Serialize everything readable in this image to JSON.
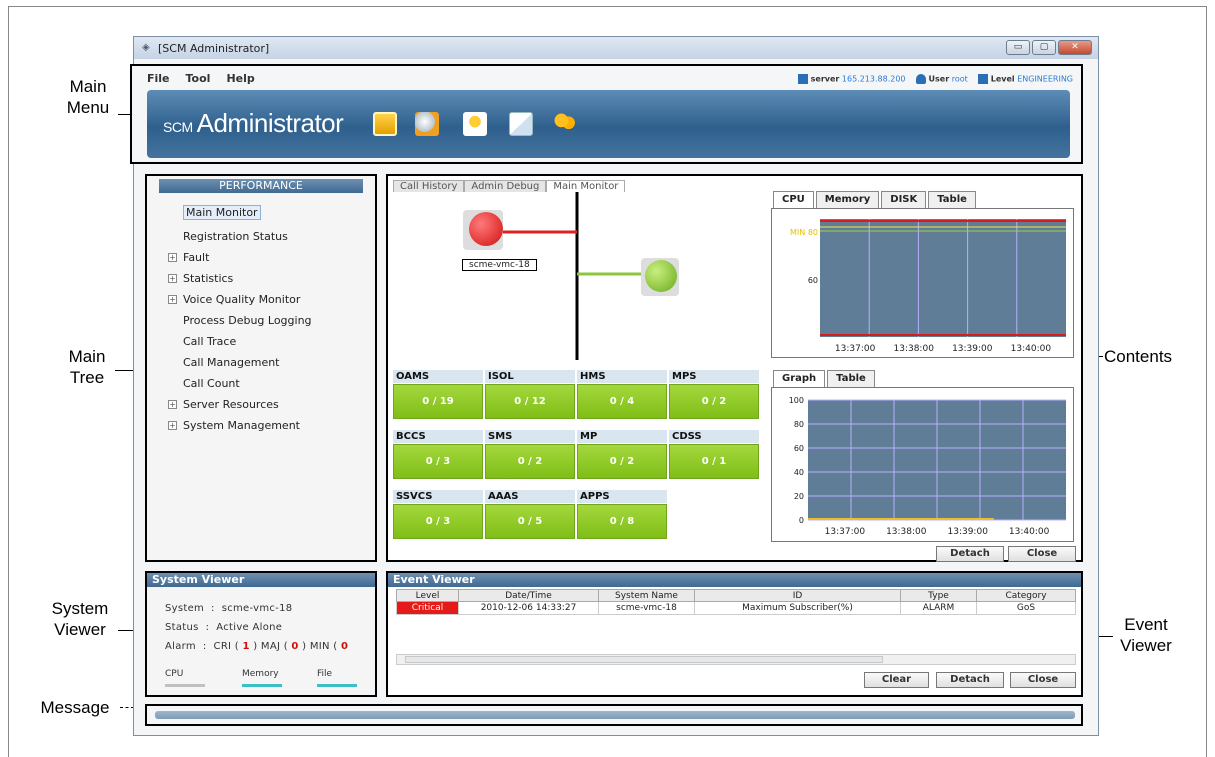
{
  "callouts": {
    "main_menu": "Main\nMenu",
    "main_tree": "Main\nTree",
    "system_viewer": "System\nViewer",
    "message": "Message",
    "contents": "Contents",
    "event_viewer": "Event\nViewer"
  },
  "window": {
    "title": "[SCM Administrator]",
    "btn_min": "▭",
    "btn_max": "▢",
    "btn_close": "✕"
  },
  "menu": {
    "items": [
      "File",
      "Tool",
      "Help"
    ],
    "server_label": "server",
    "server_value": "165.213.88.200",
    "user_label": "User",
    "user_value": "root",
    "level_label": "Level",
    "level_value": "ENGINEERING"
  },
  "banner": {
    "logo_prefix": "SCM",
    "logo_text": "Administrator",
    "toolbar_icons": [
      "performance-report-icon",
      "config-gear-icon",
      "monitor-icon",
      "mail-icon",
      "users-icon"
    ]
  },
  "tree": {
    "header": "PERFORMANCE",
    "items": [
      {
        "label": "Main Monitor",
        "expandable": false
      },
      {
        "label": "Registration Status",
        "expandable": false
      },
      {
        "label": "Fault",
        "expandable": true
      },
      {
        "label": "Statistics",
        "expandable": true
      },
      {
        "label": "Voice Quality Monitor",
        "expandable": true
      },
      {
        "label": "Process Debug Logging",
        "expandable": false
      },
      {
        "label": "Call Trace",
        "expandable": false
      },
      {
        "label": "Call Management",
        "expandable": false
      },
      {
        "label": "Call Count",
        "expandable": false
      },
      {
        "label": "Server Resources",
        "expandable": true
      },
      {
        "label": "System Management",
        "expandable": true
      }
    ]
  },
  "system_viewer": {
    "title": "System Viewer",
    "system_label": "System",
    "system_value": "scme-vmc-18",
    "status_label": "Status",
    "status_value": "Active Alone",
    "alarm_label": "Alarm",
    "cri_label": "CRI",
    "cri_value": "1",
    "maj_label": "MAJ",
    "maj_value": "0",
    "min_label": "MIN",
    "min_value": "0",
    "meters": [
      "CPU",
      "Memory",
      "File"
    ]
  },
  "contents": {
    "top_tabs": [
      "Call History",
      "Admin Debug",
      "Main Monitor"
    ],
    "node_label": "scme-vmc-18",
    "tiles": [
      {
        "name": "OAMS",
        "value": "0 / 19"
      },
      {
        "name": "ISOL",
        "value": "0 / 12"
      },
      {
        "name": "HMS",
        "value": "0 / 4"
      },
      {
        "name": "MPS",
        "value": "0 / 2"
      },
      {
        "name": "BCCS",
        "value": "0 / 3"
      },
      {
        "name": "SMS",
        "value": "0 / 2"
      },
      {
        "name": "MP",
        "value": "0 / 2"
      },
      {
        "name": "CDSS",
        "value": "0 / 1"
      },
      {
        "name": "SSVCS",
        "value": "0 / 3"
      },
      {
        "name": "AAAS",
        "value": "0 / 5"
      },
      {
        "name": "APPS",
        "value": "0 / 8"
      }
    ],
    "chart_tabs_top": [
      "CPU",
      "Memory",
      "DISK",
      "Table"
    ],
    "chart_tabs_bottom": [
      "Graph",
      "Table"
    ],
    "detach_label": "Detach",
    "close_label": "Close"
  },
  "chart_data": [
    {
      "type": "line",
      "title": "",
      "x": [
        "13:37:00",
        "13:38:00",
        "13:39:00",
        "13:40:00"
      ],
      "ytick_labels": [
        "MIN 80",
        "60"
      ],
      "grid": true
    },
    {
      "type": "line",
      "title": "",
      "x": [
        "13:37:00",
        "13:38:00",
        "13:39:00",
        "13:40:00"
      ],
      "ylim": [
        0,
        100
      ],
      "yticks": [
        0,
        20,
        40,
        60,
        80,
        100
      ],
      "grid": true
    }
  ],
  "event_viewer": {
    "title": "Event Viewer",
    "columns": [
      "Level",
      "Date/Time",
      "System Name",
      "ID",
      "Type",
      "Category"
    ],
    "rows": [
      [
        "Critical",
        "2010-12-06 14:33:27",
        "scme-vmc-18",
        "Maximum Subscriber(%)",
        "ALARM",
        "GoS"
      ]
    ],
    "clear_label": "Clear",
    "detach_label": "Detach",
    "close_label": "Close"
  },
  "colors": {
    "critical": "#e51a1a",
    "tile_green": "#8cc625",
    "panel_header": "#4f7aa1",
    "chart_bg": "#5f7d96"
  }
}
